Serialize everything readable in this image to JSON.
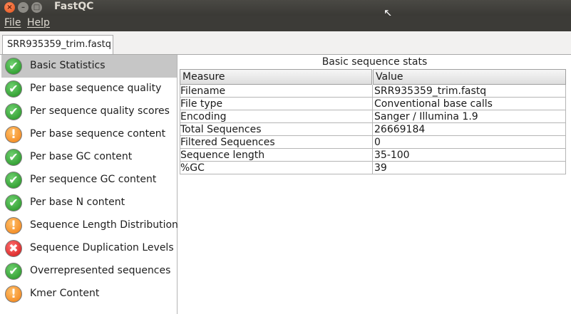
{
  "window": {
    "title": "FastQC"
  },
  "menu": {
    "file": "File",
    "help": "Help"
  },
  "tab": {
    "label": "SRR935359_trim.fastq"
  },
  "modules": [
    {
      "label": "Basic Statistics",
      "status": "pass",
      "icon": "check-icon"
    },
    {
      "label": "Per base sequence quality",
      "status": "pass",
      "icon": "check-icon"
    },
    {
      "label": "Per sequence quality scores",
      "status": "pass",
      "icon": "check-icon"
    },
    {
      "label": "Per base sequence content",
      "status": "warn",
      "icon": "exclamation-icon"
    },
    {
      "label": "Per base GC content",
      "status": "pass",
      "icon": "check-icon"
    },
    {
      "label": "Per sequence GC content",
      "status": "pass",
      "icon": "check-icon"
    },
    {
      "label": "Per base N content",
      "status": "pass",
      "icon": "check-icon"
    },
    {
      "label": "Sequence Length Distribution",
      "status": "warn",
      "icon": "exclamation-icon"
    },
    {
      "label": "Sequence Duplication Levels",
      "status": "fail",
      "icon": "cross-icon"
    },
    {
      "label": "Overrepresented sequences",
      "status": "pass",
      "icon": "check-icon"
    },
    {
      "label": "Kmer Content",
      "status": "warn",
      "icon": "exclamation-icon"
    }
  ],
  "selected_module": "Basic Statistics",
  "panel": {
    "title": "Basic sequence stats",
    "columns": [
      "Measure",
      "Value"
    ],
    "rows": [
      [
        "Filename",
        "SRR935359_trim.fastq"
      ],
      [
        "File type",
        "Conventional base calls"
      ],
      [
        "Encoding",
        "Sanger / Illumina 1.9"
      ],
      [
        "Total Sequences",
        "26669184"
      ],
      [
        "Filtered Sequences",
        "0"
      ],
      [
        "Sequence length",
        "35-100"
      ],
      [
        "%GC",
        "39"
      ]
    ]
  },
  "colors": {
    "pass": "#1f8f1f",
    "warn": "#f07d10",
    "fail": "#d01212",
    "selected": "#c6c6c6"
  }
}
